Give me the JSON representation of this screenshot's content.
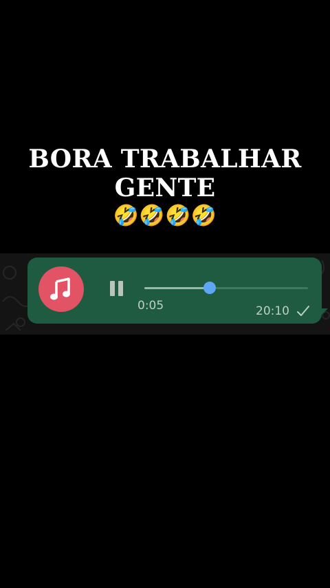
{
  "caption": {
    "line1": "BORA TRABALHAR",
    "line2": "GENTE",
    "emoji": "🤣🤣🤣🤣"
  },
  "voice_message": {
    "avatar_icon": "music-note-icon",
    "control_icon": "pause-icon",
    "elapsed": "0:05",
    "timestamp": "20:10",
    "status_icon": "single-check-icon",
    "progress": 0.4,
    "colors": {
      "bubble": "#1f5b40",
      "avatar": "#e35366",
      "thumb": "#5ea7f5"
    }
  }
}
